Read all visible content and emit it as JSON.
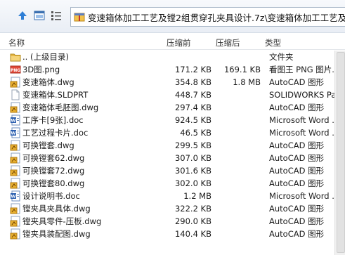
{
  "path": "变速箱体加工工艺及镗2组贯穿孔夹具设计.7z\\变速箱体加工工艺及镗2",
  "columns": {
    "name": "名称",
    "original_size": "压缩前",
    "compressed_size": "压缩后",
    "type": "类型"
  },
  "files": [
    {
      "name": ".. (上级目录)",
      "original_size": "",
      "compressed_size": "",
      "type": "文件夹",
      "icon": "folder-icon"
    },
    {
      "name": "3D图.png",
      "original_size": "171.2 KB",
      "compressed_size": "169.1 KB",
      "type": "看图王 PNG 图片...",
      "icon": "png-icon"
    },
    {
      "name": "变速箱体.dwg",
      "original_size": "354.8 KB",
      "compressed_size": "1.8 MB",
      "type": "AutoCAD 图形",
      "icon": "dwg-icon"
    },
    {
      "name": "变速箱体.SLDPRT",
      "original_size": "448.7 KB",
      "compressed_size": "",
      "type": "SOLIDWORKS Pa...",
      "icon": "blank-file-icon"
    },
    {
      "name": "变速箱体毛胚图.dwg",
      "original_size": "297.4 KB",
      "compressed_size": "",
      "type": "AutoCAD 图形",
      "icon": "dwg-icon"
    },
    {
      "name": "工序卡[9张].doc",
      "original_size": "924.5 KB",
      "compressed_size": "",
      "type": "Microsoft Word ...",
      "icon": "doc-icon"
    },
    {
      "name": "工艺过程卡片.doc",
      "original_size": "46.5 KB",
      "compressed_size": "",
      "type": "Microsoft Word ...",
      "icon": "doc-icon"
    },
    {
      "name": "可换镗套.dwg",
      "original_size": "299.5 KB",
      "compressed_size": "",
      "type": "AutoCAD 图形",
      "icon": "dwg-icon"
    },
    {
      "name": "可换镗套62.dwg",
      "original_size": "307.0 KB",
      "compressed_size": "",
      "type": "AutoCAD 图形",
      "icon": "dwg-icon"
    },
    {
      "name": "可换镗套72.dwg",
      "original_size": "301.6 KB",
      "compressed_size": "",
      "type": "AutoCAD 图形",
      "icon": "dwg-icon"
    },
    {
      "name": "可换镗套80.dwg",
      "original_size": "302.0 KB",
      "compressed_size": "",
      "type": "AutoCAD 图形",
      "icon": "dwg-icon"
    },
    {
      "name": "设计说明书.doc",
      "original_size": "1.2 MB",
      "compressed_size": "",
      "type": "Microsoft Word ...",
      "icon": "doc-icon"
    },
    {
      "name": "镗夹具夹具体.dwg",
      "original_size": "322.2 KB",
      "compressed_size": "",
      "type": "AutoCAD 图形",
      "icon": "dwg-icon"
    },
    {
      "name": "镗夹具零件-压板.dwg",
      "original_size": "290.0 KB",
      "compressed_size": "",
      "type": "AutoCAD 图形",
      "icon": "dwg-icon"
    },
    {
      "name": "镗夹具装配图.dwg",
      "original_size": "140.4 KB",
      "compressed_size": "",
      "type": "AutoCAD 图形",
      "icon": "dwg-icon"
    }
  ]
}
